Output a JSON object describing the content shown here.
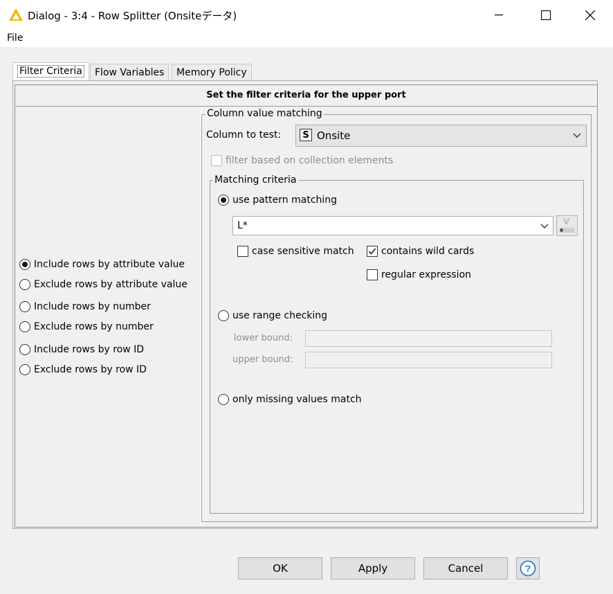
{
  "window": {
    "title": "Dialog - 3:4 - Row Splitter (Onsiteデータ)",
    "app_icon": "knime-triangle-icon",
    "controls": [
      "minimize-icon",
      "maximize-icon",
      "close-icon"
    ]
  },
  "menu": {
    "file": "File"
  },
  "tabs": [
    {
      "label": "Filter Criteria",
      "active": true
    },
    {
      "label": "Flow Variables",
      "active": false
    },
    {
      "label": "Memory Policy",
      "active": false
    }
  ],
  "panel": {
    "header": "Set the filter criteria for the upper port",
    "mode_options": [
      {
        "label": "Include rows by attribute value",
        "selected": true
      },
      {
        "label": "Exclude rows by attribute value",
        "selected": false
      },
      {
        "label": "Include rows by number",
        "selected": false
      },
      {
        "label": "Exclude rows by number",
        "selected": false
      },
      {
        "label": "Include rows by row ID",
        "selected": false
      },
      {
        "label": "Exclude rows by row ID",
        "selected": false
      }
    ],
    "column_group": {
      "legend": "Column value matching",
      "column_label": "Column to test:",
      "column_type_badge": "S",
      "column_value": "Onsite",
      "collection_label": "filter based on collection elements",
      "collection_checked": false
    },
    "matching": {
      "legend": "Matching criteria",
      "pattern_label": "use pattern matching",
      "pattern_selected": true,
      "pattern_value": "L*",
      "flow_var_badge": "V",
      "case_sensitive_label": "case sensitive match",
      "case_sensitive_checked": false,
      "wildcards_label": "contains wild cards",
      "wildcards_checked": true,
      "regex_label": "regular expression",
      "regex_checked": false,
      "range_label": "use range checking",
      "range_selected": false,
      "lower_label": "lower bound:",
      "upper_label": "upper bound:",
      "lower_value": "",
      "upper_value": "",
      "missing_label": "only missing values match",
      "missing_selected": false
    }
  },
  "buttons": {
    "ok": "OK",
    "apply": "Apply",
    "cancel": "Cancel",
    "help_icon": "help-icon"
  },
  "colors": {
    "accent": "#2a7bd4",
    "icon_yellow": "#f5b800"
  }
}
